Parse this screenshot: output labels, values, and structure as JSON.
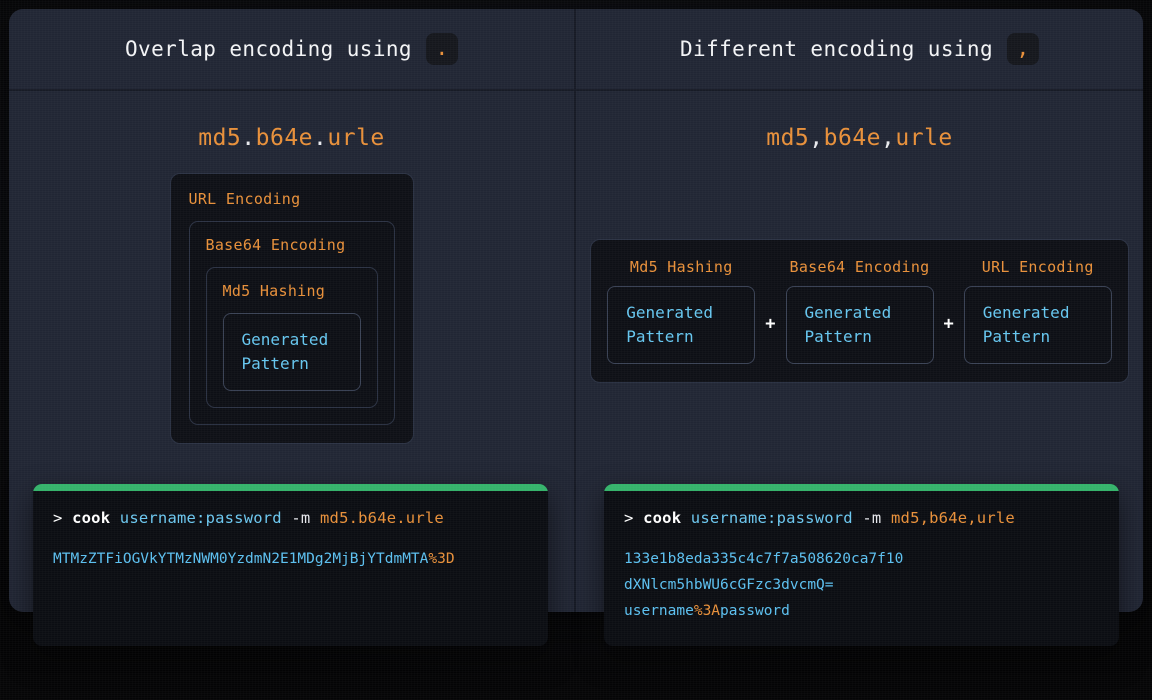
{
  "panels": [
    {
      "key": "overlap",
      "header": {
        "text": "Overlap encoding using",
        "badge": "."
      },
      "recipe": {
        "parts": [
          "md5",
          "b64e",
          "urle"
        ],
        "separator": "."
      },
      "diagram": {
        "type": "nested",
        "layers": [
          "URL Encoding",
          "Base64 Encoding",
          "Md5 Hashing"
        ],
        "inner_label": "Generated\nPattern",
        "inner_label_line1": "Generated",
        "inner_label_line2": "Pattern"
      },
      "terminal": {
        "prompt": ">",
        "binary": "cook",
        "argument": "username:password",
        "flag": "-m",
        "chain": "md5.b64e.urle",
        "output_lines": [
          {
            "text": "MTMzZTFiOGVkYTMzNWM0YzdmN2E1MDg2MjBjYTdmMTA",
            "escape": "%3D",
            "tail": ""
          }
        ]
      }
    },
    {
      "key": "different",
      "header": {
        "text": "Different encoding using",
        "badge": ","
      },
      "recipe": {
        "parts": [
          "md5",
          "b64e",
          "urle"
        ],
        "separator": ","
      },
      "diagram": {
        "type": "parallel",
        "columns": [
          "Md5 Hashing",
          "Base64 Encoding",
          "URL Encoding"
        ],
        "inner_label_line1": "Generated",
        "inner_label_line2": "Pattern",
        "operator": "+"
      },
      "terminal": {
        "prompt": ">",
        "binary": "cook",
        "argument": "username:password",
        "flag": "-m",
        "chain": "md5,b64e,urle",
        "output_lines": [
          {
            "text": "133e1b8eda335c4c7f7a508620ca7f10",
            "escape": "",
            "tail": ""
          },
          {
            "text": "dXNlcm5hbWU6cGFzc3dvcmQ=",
            "escape": "",
            "tail": ""
          },
          {
            "text": "username",
            "escape": "%3A",
            "tail": "password"
          }
        ]
      }
    }
  ],
  "colors": {
    "accent_orange": "#e8903a",
    "accent_cyan": "#5cc0f0",
    "terminal_bar_green": "#35b36b",
    "card_background": "#212634",
    "terminal_background": "#0b0d12"
  }
}
